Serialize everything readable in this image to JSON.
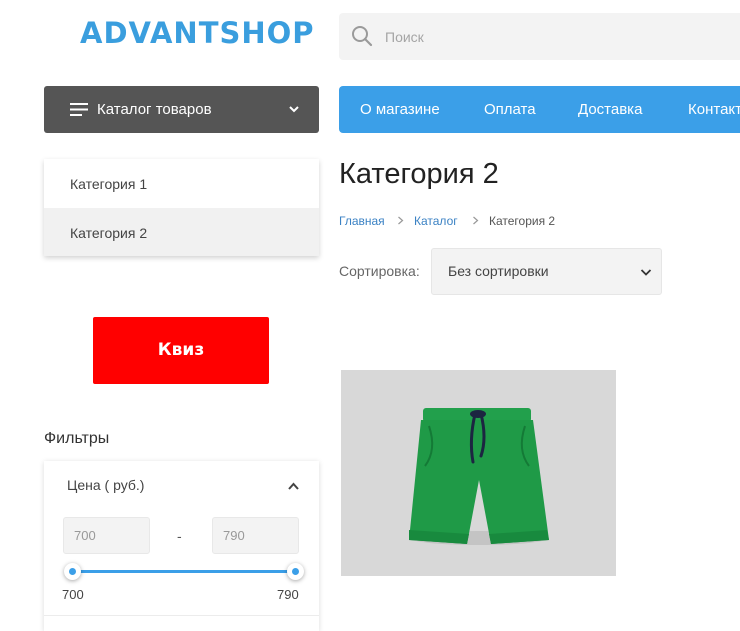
{
  "header": {
    "logo": "ADVANTSHOP",
    "search": {
      "placeholder": "Поиск",
      "value": ""
    }
  },
  "catalog_button": {
    "label": "Каталог товаров"
  },
  "top_nav": {
    "items": [
      {
        "label": "О магазине"
      },
      {
        "label": "Оплата"
      },
      {
        "label": "Доставка"
      },
      {
        "label": "Контакты"
      }
    ]
  },
  "sidebar": {
    "categories": [
      {
        "label": "Категория 1",
        "active": false
      },
      {
        "label": "Категория 2",
        "active": true
      }
    ],
    "quiz_label": "Квиз",
    "filters_title": "Фильтры",
    "price": {
      "title": "Цена ( руб.)",
      "min_value": "700",
      "max_value": "790",
      "range_min_label": "700",
      "range_max_label": "790",
      "separator": "-"
    }
  },
  "main": {
    "title": "Категория 2",
    "breadcrumbs": [
      {
        "label": "Главная",
        "link": true
      },
      {
        "label": "Каталог",
        "link": true
      },
      {
        "label": "Категория 2",
        "link": false
      }
    ],
    "sort": {
      "label": "Сортировка:",
      "selected": "Без сортировки"
    },
    "products": [
      {
        "image": "green-shorts"
      }
    ]
  },
  "colors": {
    "accent": "#3b9fe8",
    "logo": "#3a9ede",
    "quiz": "#ff0000",
    "catalog_button": "#555555",
    "product_green": "#1f9a47"
  }
}
